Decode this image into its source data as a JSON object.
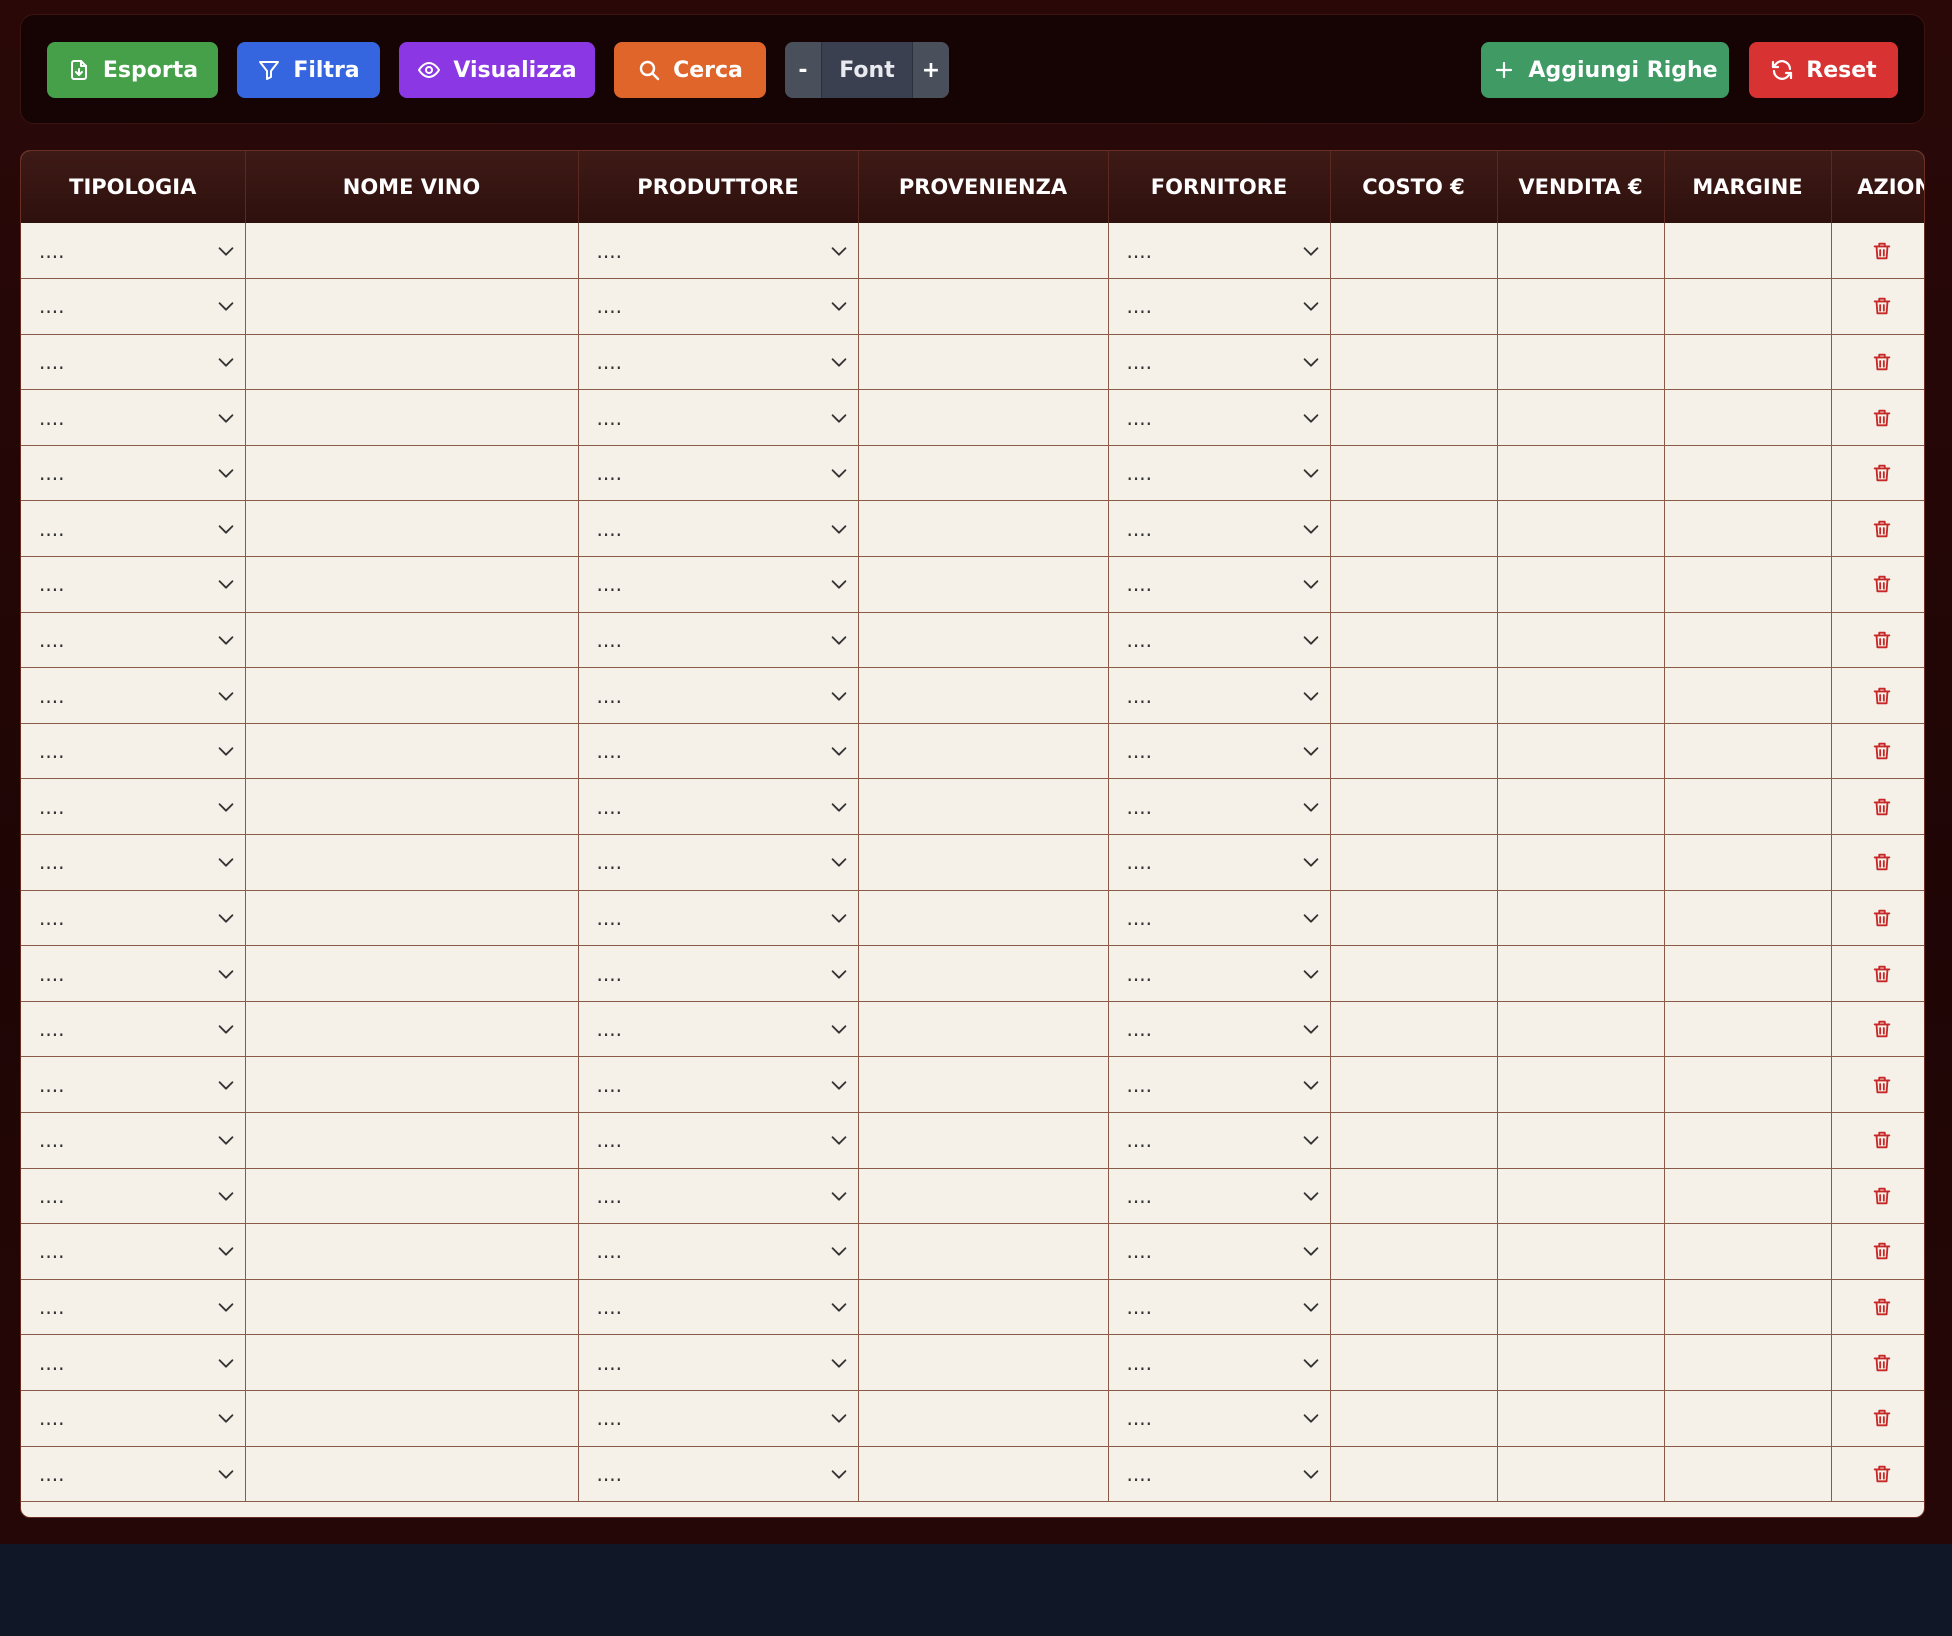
{
  "toolbar": {
    "export_label": "Esporta",
    "filter_label": "Filtra",
    "view_label": "Visualizza",
    "search_label": "Cerca",
    "font_decrease": "-",
    "font_label": "Font",
    "font_increase": "+",
    "add_rows_label": "Aggiungi Righe",
    "reset_label": "Reset"
  },
  "table": {
    "columns": [
      "TIPOLOGIA",
      "NOME VINO",
      "PRODUTTORE",
      "PROVENIENZA",
      "FORNITORE",
      "COSTO €",
      "VENDITA €",
      "MARGINE",
      "AZIONI"
    ],
    "placeholder": "....",
    "row_count": 23
  },
  "colors": {
    "export": "#45a049",
    "filter": "#3566e0",
    "view": "#8b37e3",
    "search": "#e0652a",
    "add": "#3f9a64",
    "reset": "#d83232",
    "trash": "#c62828"
  }
}
